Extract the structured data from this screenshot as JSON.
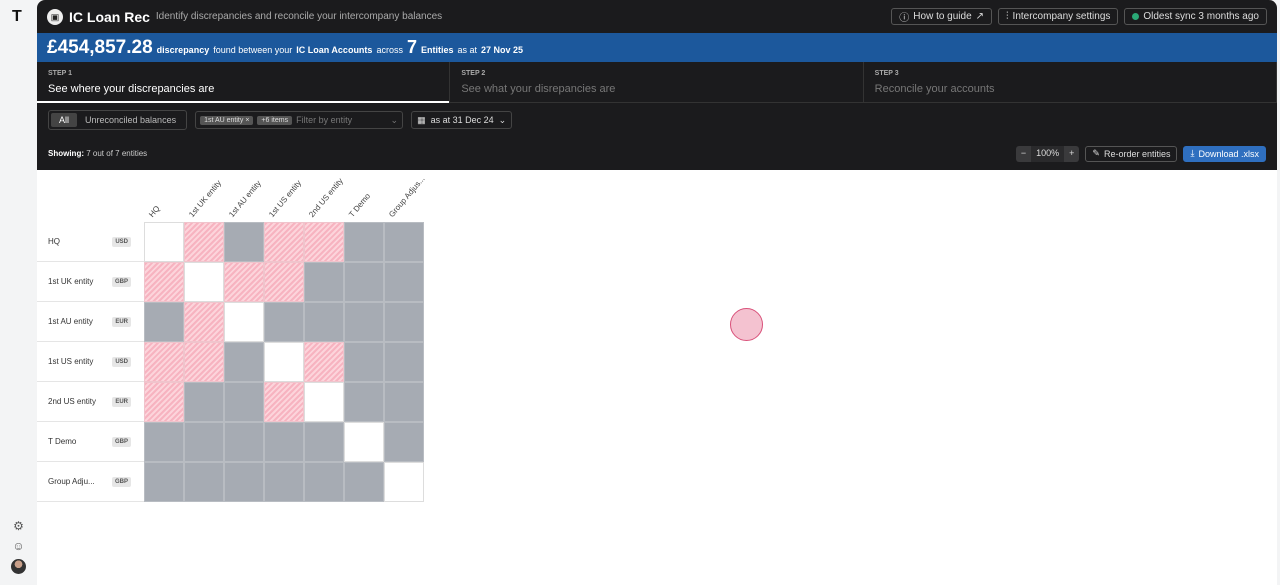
{
  "app": {
    "title": "IC Loan Rec",
    "subtitle": "Identify discrepancies and reconcile your intercompany balances",
    "logo": "T"
  },
  "header_buttons": {
    "guide": "How to guide",
    "settings": "Intercompany settings",
    "sync": "Oldest sync 3 months ago"
  },
  "banner": {
    "amount": "£454,857.28",
    "t1": "discrepancy",
    "t2": "found between your",
    "t3": "IC Loan Accounts",
    "t4": "across",
    "count": "7",
    "t5": "Entities",
    "t6": "as at",
    "date": "27 Nov 25"
  },
  "steps": [
    {
      "k": "STEP 1",
      "t": "See where your discrepancies are"
    },
    {
      "k": "STEP 2",
      "t": "See what your disrepancies are"
    },
    {
      "k": "STEP 3",
      "t": "Reconcile your accounts"
    }
  ],
  "filters": {
    "all": "All",
    "unrec": "Unreconciled balances",
    "chip1": "1st AU entity",
    "chip2": "+6 items",
    "placeholder": "Filter by entity",
    "date": "as at 31 Dec 24"
  },
  "showing": {
    "label": "Showing:",
    "value": "7 out of 7 entities"
  },
  "toolbar": {
    "minus": "−",
    "zoom": "100%",
    "plus": "+",
    "reorder": "Re-order entities",
    "download": "Download .xlsx"
  },
  "colors": {
    "accent": "#1c589c",
    "discrepancy": "#f7b3c0",
    "na": "#a6abb3"
  },
  "matrix": {
    "columns": [
      "HQ",
      "1st UK entity",
      "1st AU entity",
      "1st US entity",
      "2nd US entity",
      "T Demo",
      "Group Adjus..."
    ],
    "rows": [
      {
        "name": "HQ",
        "currency": "USD",
        "cells": "wpgppgg"
      },
      {
        "name": "1st UK entity",
        "currency": "GBP",
        "cells": "pwppggg"
      },
      {
        "name": "1st AU entity",
        "currency": "EUR",
        "cells": "gpwgggg"
      },
      {
        "name": "1st US entity",
        "currency": "USD",
        "cells": "ppgwpgg"
      },
      {
        "name": "2nd US entity",
        "currency": "EUR",
        "cells": "pggpwgg"
      },
      {
        "name": "T Demo",
        "currency": "GBP",
        "cells": "gggggwg"
      },
      {
        "name": "Group Adju...",
        "currency": "GBP",
        "cells": "ggggggw"
      }
    ]
  }
}
